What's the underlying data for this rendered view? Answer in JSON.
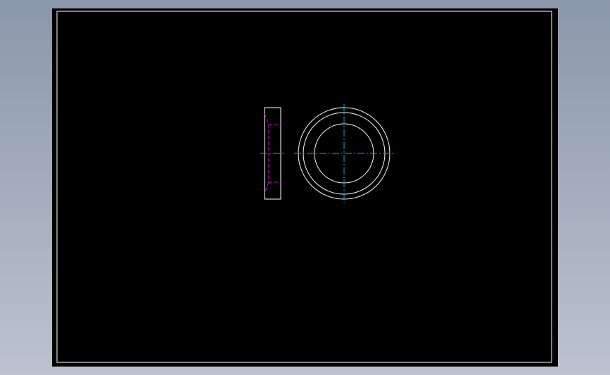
{
  "colors": {
    "background_top": "#8b97ab",
    "background_bottom": "#bcc3cf",
    "drawing_area": "#000000",
    "geometry_line": "#ffffff",
    "center_line": "#00b4d8",
    "hidden_line": "#e000e0"
  },
  "drawing": {
    "views": [
      "side-view",
      "front-view"
    ],
    "line_types": {
      "geometry": "continuous",
      "center": "dash-dot",
      "hidden": "dashed"
    }
  }
}
